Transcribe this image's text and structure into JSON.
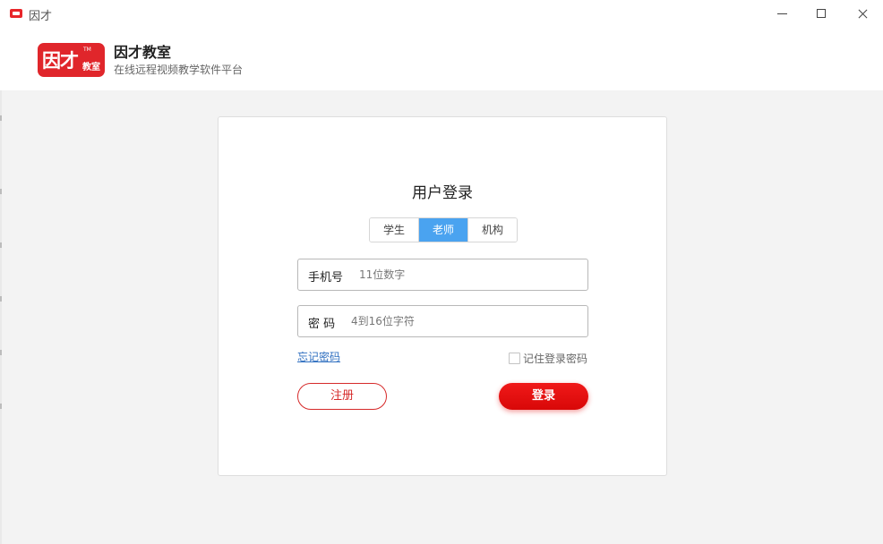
{
  "window": {
    "title": "因才",
    "controls": {
      "minimize": "minimize-icon",
      "maximize": "maximize-icon",
      "close": "close-icon"
    }
  },
  "header": {
    "logo_text": "因才",
    "logo_small_text": "教室",
    "logo_tm": "TM",
    "brand_name": "因才教室",
    "subtitle": "在线远程视频教学软件平台"
  },
  "login": {
    "title": "用户登录",
    "roles": [
      {
        "label": "学生",
        "active": false
      },
      {
        "label": "老师",
        "active": true
      },
      {
        "label": "机构",
        "active": false
      }
    ],
    "phone_label": "手机号",
    "phone_placeholder": "11位数字",
    "phone_value": "",
    "password_label": "密 码",
    "password_placeholder": "4到16位字符",
    "password_value": "",
    "forgot_label": "忘记密码",
    "remember_label": "记住登录密码",
    "remember_checked": false,
    "register_label": "注册",
    "login_label": "登录"
  },
  "colors": {
    "accent_blue": "#4aa3f0",
    "brand_red": "#e0262b",
    "login_red": "#e61010",
    "link_blue": "#2f6fc0"
  }
}
